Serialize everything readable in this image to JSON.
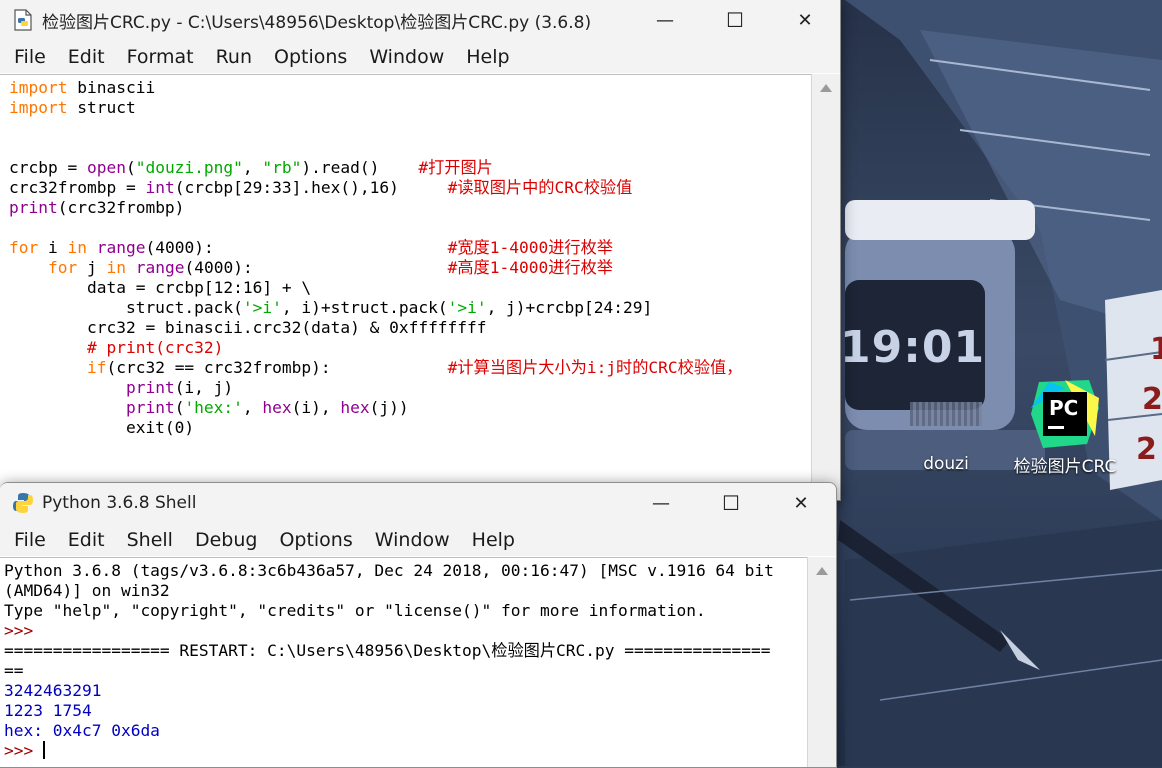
{
  "desktop": {
    "icons": [
      {
        "label": "douzi",
        "icon": "image-thumbnail-icon"
      },
      {
        "label": "检验图片CRC",
        "icon": "pycharm-icon",
        "logo_text": "PC"
      }
    ],
    "wallpaper_clock": "19:01",
    "wallpaper_digits": [
      "1",
      "2",
      "2"
    ]
  },
  "editor": {
    "title": "检验图片CRC.py - C:\\Users\\48956\\Desktop\\检验图片CRC.py (3.6.8)",
    "menu": [
      "File",
      "Edit",
      "Format",
      "Run",
      "Options",
      "Window",
      "Help"
    ],
    "lines": [
      [
        {
          "t": "import",
          "c": "kw"
        },
        {
          "t": " binascii"
        }
      ],
      [
        {
          "t": "import",
          "c": "kw"
        },
        {
          "t": " struct"
        }
      ],
      [],
      [],
      [
        {
          "t": "crcbp = "
        },
        {
          "t": "open",
          "c": "bi"
        },
        {
          "t": "("
        },
        {
          "t": "\"douzi.png\"",
          "c": "str"
        },
        {
          "t": ", "
        },
        {
          "t": "\"rb\"",
          "c": "str"
        },
        {
          "t": ").read()    "
        },
        {
          "t": "#打开图片",
          "c": "cm"
        }
      ],
      [
        {
          "t": "crc32frombp = "
        },
        {
          "t": "int",
          "c": "bi"
        },
        {
          "t": "(crcbp[29:33].hex(),16)     "
        },
        {
          "t": "#读取图片中的CRC校验值",
          "c": "cm"
        }
      ],
      [
        {
          "t": "print",
          "c": "bi"
        },
        {
          "t": "(crc32frombp)"
        }
      ],
      [],
      [
        {
          "t": "for",
          "c": "kw"
        },
        {
          "t": " i "
        },
        {
          "t": "in",
          "c": "kw"
        },
        {
          "t": " "
        },
        {
          "t": "range",
          "c": "bi"
        },
        {
          "t": "(4000):                        "
        },
        {
          "t": "#宽度1-4000进行枚举",
          "c": "cm"
        }
      ],
      [
        {
          "t": "    "
        },
        {
          "t": "for",
          "c": "kw"
        },
        {
          "t": " j "
        },
        {
          "t": "in",
          "c": "kw"
        },
        {
          "t": " "
        },
        {
          "t": "range",
          "c": "bi"
        },
        {
          "t": "(4000):                    "
        },
        {
          "t": "#高度1-4000进行枚举",
          "c": "cm"
        }
      ],
      [
        {
          "t": "        data = crcbp[12:16] + \\"
        }
      ],
      [
        {
          "t": "            struct.pack("
        },
        {
          "t": "'>i'",
          "c": "str"
        },
        {
          "t": ", i)+struct.pack("
        },
        {
          "t": "'>i'",
          "c": "str"
        },
        {
          "t": ", j)+crcbp[24:29]"
        }
      ],
      [
        {
          "t": "        crc32 = binascii.crc32(data) & 0xffffffff"
        }
      ],
      [
        {
          "t": "        "
        },
        {
          "t": "# print(crc32)",
          "c": "cm"
        }
      ],
      [
        {
          "t": "        "
        },
        {
          "t": "if",
          "c": "kw"
        },
        {
          "t": "(crc32 == crc32frombp):            "
        },
        {
          "t": "#计算当图片大小为i:j时的CRC校验值，",
          "c": "cm"
        }
      ],
      [
        {
          "t": "            "
        },
        {
          "t": "print",
          "c": "bi"
        },
        {
          "t": "(i, j)"
        }
      ],
      [
        {
          "t": "            "
        },
        {
          "t": "print",
          "c": "bi"
        },
        {
          "t": "("
        },
        {
          "t": "'hex:'",
          "c": "str"
        },
        {
          "t": ", "
        },
        {
          "t": "hex",
          "c": "bi"
        },
        {
          "t": "(i), "
        },
        {
          "t": "hex",
          "c": "bi"
        },
        {
          "t": "(j))"
        }
      ],
      [
        {
          "t": "            exit(0)"
        }
      ]
    ]
  },
  "shell": {
    "title": "Python 3.6.8 Shell",
    "menu": [
      "File",
      "Edit",
      "Shell",
      "Debug",
      "Options",
      "Window",
      "Help"
    ],
    "lines": [
      [
        {
          "t": "Python 3.6.8 (tags/v3.6.8:3c6b436a57, Dec 24 2018, 00:16:47) [MSC v.1916 64 bit"
        }
      ],
      [
        {
          "t": "(AMD64)] on win32"
        }
      ],
      [
        {
          "t": "Type \"help\", \"copyright\", \"credits\" or \"license()\" for more information."
        }
      ],
      [
        {
          "t": ">>> ",
          "c": "prompt"
        }
      ],
      [
        {
          "t": "================= RESTART: C:\\Users\\48956\\Desktop\\检验图片CRC.py ==============="
        }
      ],
      [
        {
          "t": "=="
        }
      ],
      [
        {
          "t": "3242463291",
          "c": "out"
        }
      ],
      [
        {
          "t": "1223 1754",
          "c": "out"
        }
      ],
      [
        {
          "t": "hex: 0x4c7 0x6da",
          "c": "out"
        }
      ],
      [
        {
          "t": ">>> ",
          "c": "prompt"
        },
        {
          "caret": true
        }
      ]
    ]
  },
  "controls": {
    "minimize": "—",
    "maximize": "☐",
    "close": "✕"
  }
}
